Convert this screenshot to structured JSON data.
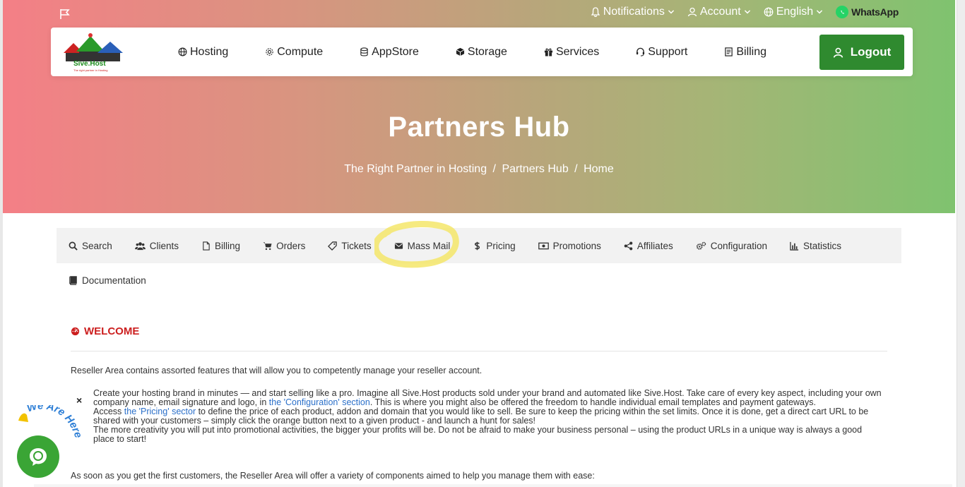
{
  "topbar": {
    "notifications": "Notifications",
    "account": "Account",
    "language": "English",
    "whatsapp": "WhatsApp"
  },
  "logo": {
    "line1": "Sive.Host",
    "tagline": "The right partner in Hosting"
  },
  "nav": {
    "items": [
      {
        "label": "Hosting",
        "icon": "globe-icon"
      },
      {
        "label": "Compute",
        "icon": "gear-icon"
      },
      {
        "label": "AppStore",
        "icon": "database-icon"
      },
      {
        "label": "Storage",
        "icon": "cube-icon"
      },
      {
        "label": "Services",
        "icon": "gift-icon"
      },
      {
        "label": "Support",
        "icon": "headset-icon"
      },
      {
        "label": "Billing",
        "icon": "invoice-icon"
      }
    ],
    "logout": "Logout"
  },
  "hero": {
    "title": "Partners Hub",
    "crumb1": "The Right Partner in Hosting",
    "crumb2": "Partners Hub",
    "crumb3": "Home",
    "sep": "/"
  },
  "tabs": {
    "items": [
      {
        "label": "Search"
      },
      {
        "label": "Clients"
      },
      {
        "label": "Billing"
      },
      {
        "label": "Orders"
      },
      {
        "label": "Tickets"
      },
      {
        "label": "Mass Mail"
      },
      {
        "label": "Pricing"
      },
      {
        "label": "Promotions"
      },
      {
        "label": "Affiliates"
      },
      {
        "label": "Configuration"
      },
      {
        "label": "Statistics"
      }
    ],
    "documentation": "Documentation"
  },
  "content": {
    "welcome": "WELCOME",
    "intro": "Reseller Area contains assorted features that will allow you to competently manage your reseller account.",
    "p1a": "Create your hosting brand in minutes — and start selling like a pro. Imagine all Sive.Host products sold under your brand and automated like Sive.Host. Take care of every key aspect, including your own company name, email signature and logo, in ",
    "p1link": "the 'Configuration' section",
    "p1b": ". This is where you might also be offered the freedom to handle individual email templates and payment gateways.",
    "p2a": "Access ",
    "p2link": "the 'Pricing' sector",
    "p2b": " to define the price of each product, addon and domain that you would like to sell. Be sure to keep the pricing within the set limits. Once it is done, get a direct cart URL to be shared with your customers – simply click the orange button next to a given product - and launch a hunt for sales!",
    "p3": "The more creativity you will put into promotional activities, the bigger your profits will be. Do not be afraid to make your business personal – using the product URLs in a unique way is always a good place to start!",
    "footer": "As soon as you get the first customers, the Reseller Area will offer a variety of components aimed to help you manage them with ease:",
    "close": "×"
  },
  "chat": {
    "badge": "We Are Here!"
  }
}
